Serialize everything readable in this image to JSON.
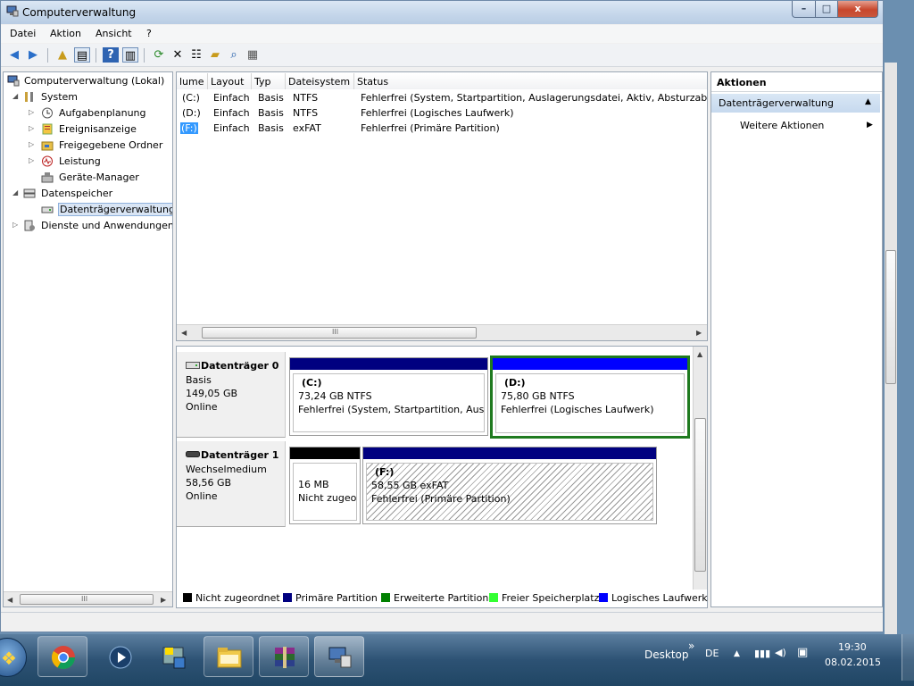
{
  "window": {
    "title": "Computerverwaltung",
    "btn_min": "–",
    "btn_max": "□",
    "btn_close": "x"
  },
  "menu": {
    "items": [
      "Datei",
      "Aktion",
      "Ansicht",
      "?"
    ]
  },
  "tree": {
    "root": "Computerverwaltung (Lokal)",
    "system": "System",
    "aufgaben": "Aufgabenplanung",
    "ereignis": "Ereignisanzeige",
    "freigabe": "Freigegebene Ordner",
    "leistung": "Leistung",
    "geraete": "Geräte-Manager",
    "datenspeicher": "Datenspeicher",
    "dtv": "Datenträgerverwaltung",
    "dienste": "Dienste und Anwendungen",
    "scroll_grip": "III"
  },
  "volumes": {
    "headers": [
      "lume",
      "Layout",
      "Typ",
      "Dateisystem",
      "Status"
    ],
    "rows": [
      [
        "(C:)",
        "Einfach",
        "Basis",
        "NTFS",
        "Fehlerfrei (System, Startpartition, Auslagerungsdatei, Aktiv, Absturzabbild,"
      ],
      [
        "(D:)",
        "Einfach",
        "Basis",
        "NTFS",
        "Fehlerfrei (Logisches Laufwerk)"
      ],
      [
        "(F:)",
        "Einfach",
        "Basis",
        "exFAT",
        "Fehlerfrei (Primäre Partition)"
      ]
    ],
    "scroll_grip": "III"
  },
  "disks": {
    "d0": {
      "name": "Datenträger 0",
      "type": "Basis",
      "size": "149,05 GB",
      "state": "Online"
    },
    "d1": {
      "name": "Datenträger 1",
      "type": "Wechselmedium",
      "size": "58,56 GB",
      "state": "Online"
    },
    "c": {
      "name": "(C:)",
      "size": "73,24 GB NTFS",
      "status": "Fehlerfrei (System, Startpartition, Auslag"
    },
    "d": {
      "name": "(D:)",
      "size": "75,80 GB NTFS",
      "status": "Fehlerfrei (Logisches Laufwerk)"
    },
    "un": {
      "size": "16 MB",
      "status": "Nicht zugeor"
    },
    "f": {
      "name": "(F:)",
      "size": "58,55 GB exFAT",
      "status": "Fehlerfrei (Primäre Partition)"
    }
  },
  "legend": {
    "unalloc": "Nicht zugeordnet",
    "primary": "Primäre Partition",
    "extended": "Erweiterte Partition",
    "free": "Freier Speicherplatz",
    "logical": "Logisches Laufwerk"
  },
  "actions": {
    "title": "Aktionen",
    "section": "Datenträgerverwaltung",
    "more": "Weitere Aktionen"
  },
  "taskbar": {
    "desktop": "Desktop",
    "lang": "DE",
    "time": "19:30",
    "date": "08.02.2015"
  },
  "colors": {
    "primary": "#000080",
    "logical": "#0000ff",
    "extended": "#008000",
    "free": "#33ff33",
    "unalloc": "#000000",
    "selection": "#3399ff"
  }
}
